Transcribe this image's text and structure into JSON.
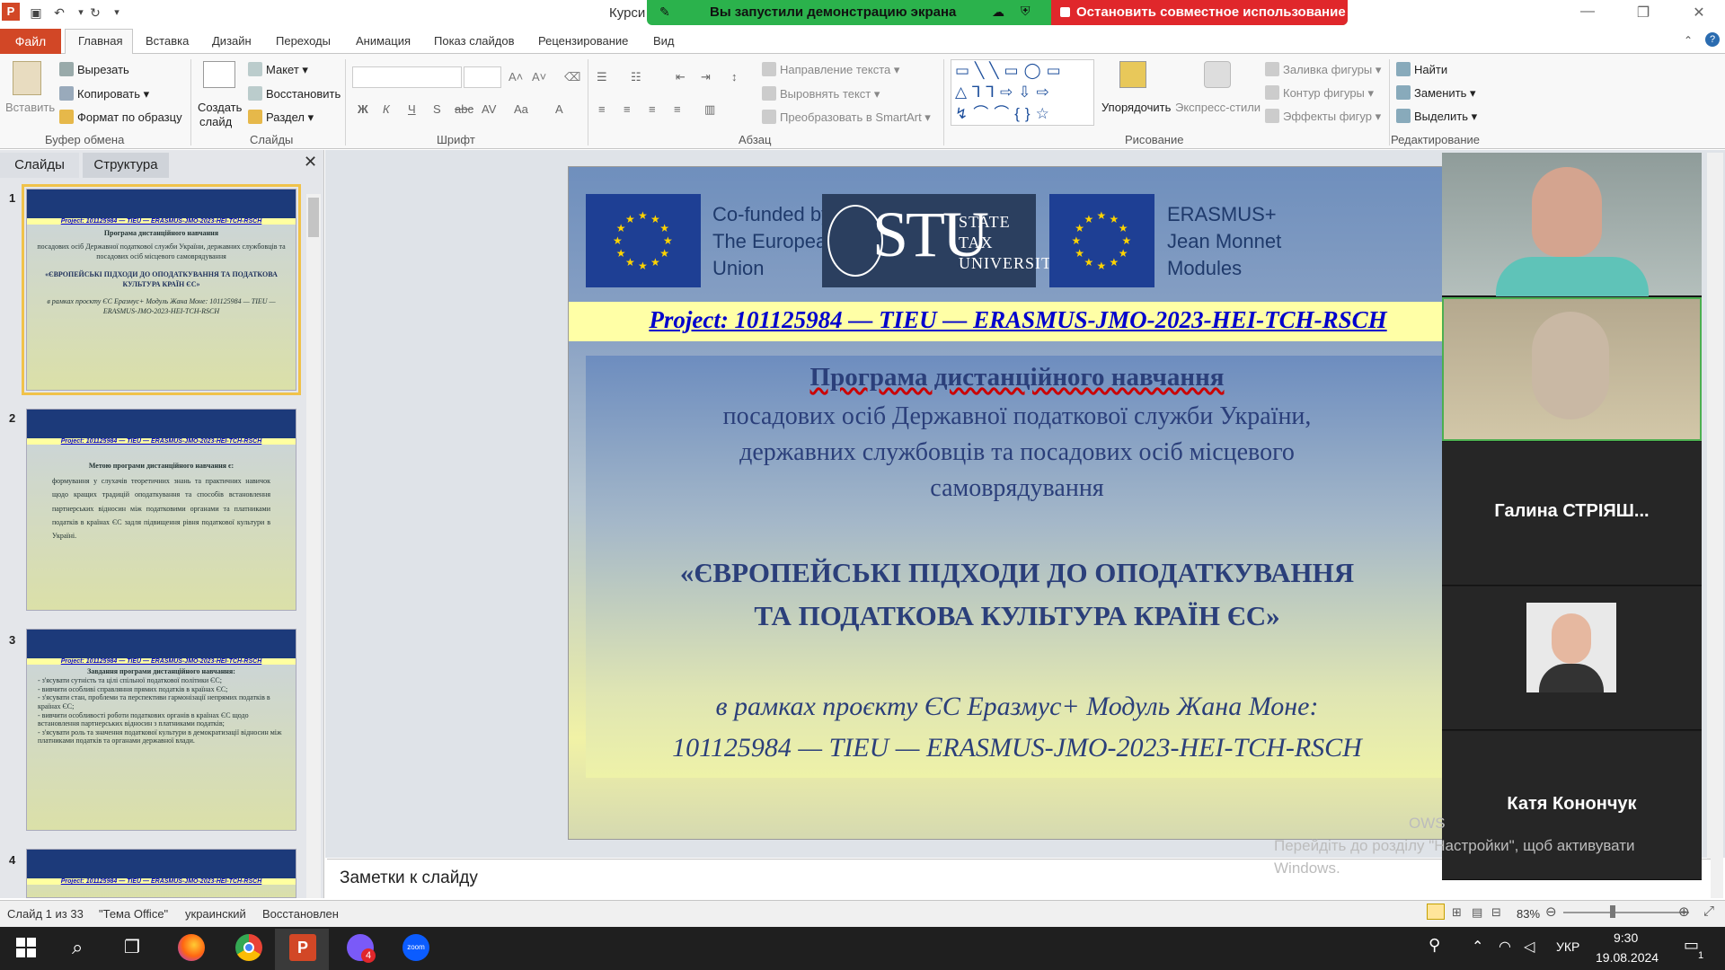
{
  "titlebar": {
    "doc_title": "Курси",
    "share_text": "Вы запустили демонстрацию экрана",
    "stop_share": "Остановить совместное использование"
  },
  "tabs": [
    "Главная",
    "Вставка",
    "Дизайн",
    "Переходы",
    "Анимация",
    "Показ слайдов",
    "Рецензирование",
    "Вид"
  ],
  "file_tab": "Файл",
  "ribbon": {
    "paste": "Вставить",
    "cut": "Вырезать",
    "copy": "Копировать",
    "format_painter": "Формат по образцу",
    "clipboard": "Буфер обмена",
    "new_slide_1": "Создать",
    "new_slide_2": "слайд",
    "layout": "Макет",
    "reset": "Восстановить",
    "section": "Раздел",
    "slides": "Слайды",
    "font": "Шрифт",
    "paragraph": "Абзац",
    "text_direction": "Направление текста",
    "align_text": "Выровнять текст",
    "smartart": "Преобразовать в SmartArt",
    "arrange": "Упорядочить",
    "quick_styles": "Экспресс-стили",
    "shape_fill": "Заливка фигуры",
    "shape_outline": "Контур фигуры",
    "shape_effects": "Эффекты фигур",
    "drawing": "Рисование",
    "find": "Найти",
    "replace": "Заменить",
    "select": "Выделить",
    "editing": "Редактирование"
  },
  "panel": {
    "tab_slides": "Слайды",
    "tab_outline": "Структура",
    "close": "✕",
    "thumbs": [
      {
        "num": "1",
        "proj": "Project: 101125984 — TIEU — ERASMUS-JMO-2023-HEI-TCH-RSCH",
        "lines": [
          "Програма дистанційного навчання",
          "посадових осіб Державної податкової служби України, державних службовців та посадових осіб місцевого самоврядування",
          "«ЄВРОПЕЙСЬКІ ПІДХОДИ ДО ОПОДАТКУВАННЯ ТА ПОДАТКОВА КУЛЬТУРА КРАЇН ЄС»",
          "в рамках проєкту ЄС Еразмус+ Модуль Жана Моне: 101125984 — TIEU — ERASMUS-JMO-2023-HEI-TCH-RSCH"
        ]
      },
      {
        "num": "2",
        "proj": "Project: 101125984 — TIEU — ERASMUS-JMO-2023-HEI-TCH-RSCH",
        "lines": [
          "Метою програми дистанційного навчання є:",
          "формування у слухачів теоретичних знань та практичних навичок щодо кращих традицій оподаткування та способів встановлення партнерських відносин між податковими органами та платниками податків в країнах ЄС задля підвищення рівня податкової культури в Україні."
        ]
      },
      {
        "num": "3",
        "proj": "Project: 101125984 — TIEU — ERASMUS-JMO-2023-HEI-TCH-RSCH",
        "lines": [
          "Завдання програми дистанційного навчання:",
          "- з'ясувати сутність та цілі спільної податкової політики ЄС;",
          "- вивчити особливі справляння прямих податків в країнах ЄС;",
          "- з'ясувати стан, проблеми та перспективи гармонізації непрямих податків в країнах ЄС;",
          "- вивчити особливості роботи податкових органів в країнах ЄС щодо встановлення партнерських відносин з платниками податків;",
          "- з'ясувати роль та значення податкової культури в демократизації відносин між платниками податків та органами державної влади."
        ]
      },
      {
        "num": "4",
        "proj": "Project: 101125984 — TIEU — ERASMUS-JMO-2023-HEI-TCH-RSCH",
        "lines": []
      }
    ],
    "cofunded": "Co-funded by the European Union"
  },
  "slide": {
    "cofunded": [
      "Co-funded by",
      "The European",
      "Union"
    ],
    "stu_big": "STU",
    "stu_small": [
      "STATE",
      "TAX",
      "UNIVERSITY"
    ],
    "erasmus": [
      "ERASMUS+",
      "Jean Monnet",
      "Modules"
    ],
    "project": "Project: 101125984 — TIEU — ERASMUS-JMO-2023-HEI-TCH-RSCH",
    "heading": "Програма дистанційного навчання",
    "line1": "посадових осіб Державної податкової служби України,",
    "line2": "державних службовців та посадових осіб місцевого",
    "line3": "самоврядування",
    "title1": "«ЄВРОПЕЙСЬКІ ПІДХОДИ ДО ОПОДАТКУВАННЯ",
    "title2": "ТА ПОДАТКОВА КУЛЬТУРА КРАЇН ЄС»",
    "italic1": "в рамках проєкту ЄС Еразмус+ Модуль Жана Моне:",
    "italic2": "101125984 — TIEU — ERASMUS-JMO-2023-HEI-TCH-RSCH"
  },
  "notes": "Заметки к слайду",
  "status": {
    "slide_of": "Слайд 1 из 33",
    "theme": "\"Тема Office\"",
    "lang": "украинский",
    "state": "Восстановлен",
    "zoom": "83%"
  },
  "zoom_call": {
    "p3": "Галина  СТРІЯШ...",
    "p5": "Катя Конончук"
  },
  "watermark": [
    "OWS",
    "Перейдіть до розділу \"Настройки\", щоб активувати",
    "Windows."
  ],
  "taskbar": {
    "time": "9:30",
    "date": "19.08.2024",
    "lang": "УКР",
    "notif": "1",
    "badge": "4"
  },
  "colors": {
    "accent": "#d24726",
    "share_green": "#2bb24c",
    "stop_red": "#e0272b",
    "eu_blue": "#1e3f94",
    "slide_text": "#2b3f7a",
    "project_link": "#0000cc"
  }
}
